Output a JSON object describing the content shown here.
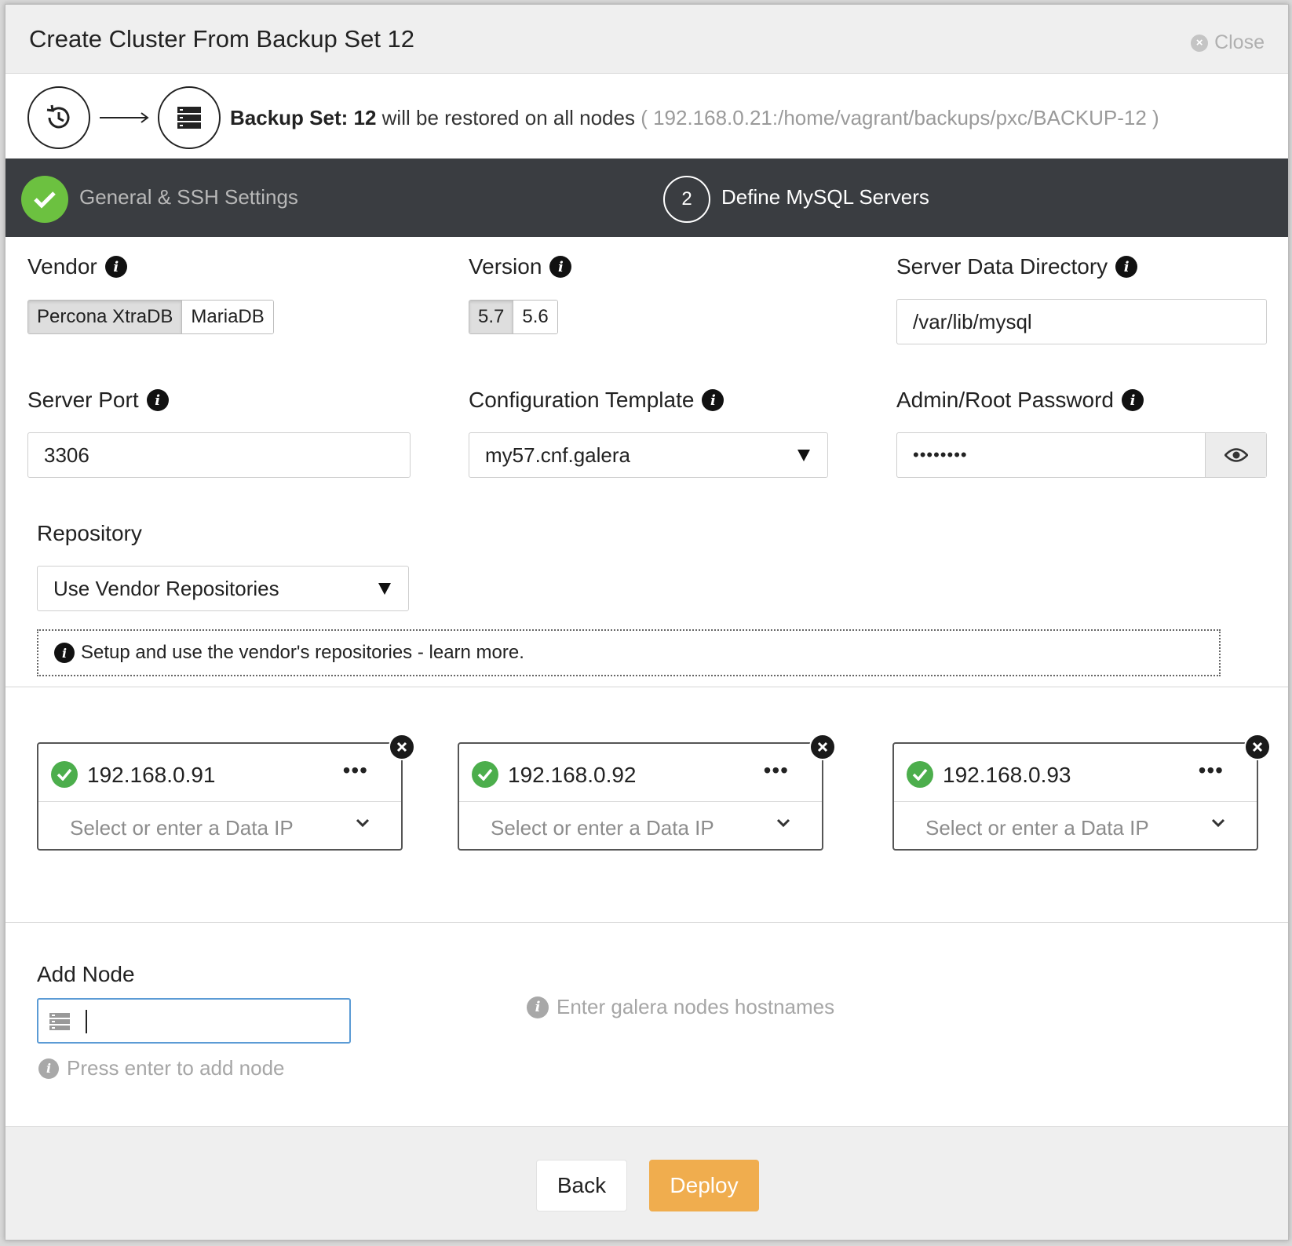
{
  "dialog": {
    "title": "Create Cluster From Backup Set 12",
    "close_label": "Close"
  },
  "backup": {
    "prefix": "Backup Set:",
    "number": "12",
    "middle": "will be restored on all nodes",
    "path": "( 192.168.0.21:/home/vagrant/backups/pxc/BACKUP-12 )"
  },
  "steps": [
    {
      "label": "General & SSH Settings",
      "status": "done"
    },
    {
      "number": "2",
      "label": "Define MySQL Servers",
      "status": "active"
    }
  ],
  "form": {
    "vendor": {
      "label": "Vendor",
      "options": [
        "Percona XtraDB",
        "MariaDB"
      ],
      "selected": "Percona XtraDB"
    },
    "version": {
      "label": "Version",
      "options": [
        "5.7",
        "5.6"
      ],
      "selected": "5.7"
    },
    "data_dir": {
      "label": "Server Data Directory",
      "value": "/var/lib/mysql"
    },
    "port": {
      "label": "Server Port",
      "value": "3306"
    },
    "config_template": {
      "label": "Configuration Template",
      "value": "my57.cnf.galera"
    },
    "password": {
      "label": "Admin/Root Password",
      "value": "••••••••"
    },
    "repository": {
      "label": "Repository",
      "value": "Use Vendor Repositories"
    },
    "repo_notice": "Setup and use the vendor's repositories - learn more."
  },
  "nodes": [
    {
      "ip": "192.168.0.91",
      "data_ip_placeholder": "Select or enter a Data IP"
    },
    {
      "ip": "192.168.0.92",
      "data_ip_placeholder": "Select or enter a Data IP"
    },
    {
      "ip": "192.168.0.93",
      "data_ip_placeholder": "Select or enter a Data IP"
    }
  ],
  "node_more_label": "•••",
  "add_node": {
    "label": "Add Node",
    "value": "",
    "hint": "Press enter to add node",
    "side_hint": "Enter galera nodes hostnames"
  },
  "footer": {
    "back_label": "Back",
    "deploy_label": "Deploy"
  },
  "colors": {
    "success": "#6cc140",
    "deploy": "#f0ad4e",
    "stepbar": "#3a3d41",
    "focus": "#5b9bd5"
  }
}
